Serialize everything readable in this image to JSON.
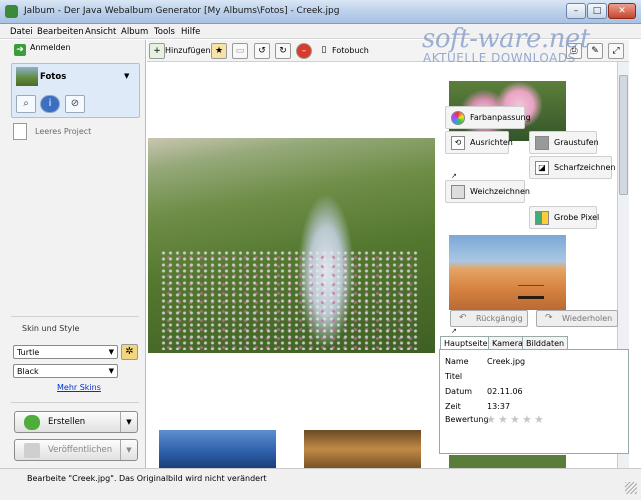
{
  "window": {
    "title": "Jalbum - Der Java Webalbum Generator [My Albums\\Fotos] - Creek.jpg",
    "min_glyph": "–",
    "max_glyph": "□",
    "close_glyph": "✕"
  },
  "menu": [
    "Datei",
    "Bearbeiten",
    "Ansicht",
    "Album",
    "Tools",
    "Hilfe"
  ],
  "watermark": {
    "line1": "soft-ware.net",
    "line2": "AKTUELLE DOWNLOADS"
  },
  "left": {
    "login_label": "Anmelden",
    "album_title": "Fotos",
    "project_label": "Leeres Project",
    "skin_section": "Skin und Style",
    "skin_value": "Turtle",
    "style_value": "Black",
    "more_skins": "Mehr Skins",
    "make_label": "Erstellen",
    "publish_label": "Veröffentlichen"
  },
  "toolbar": {
    "add_label": "Hinzufügen",
    "book_label": "Fotobuch"
  },
  "edit": {
    "color": "Farbanpassung",
    "align": "Ausrichten",
    "gray": "Graustufen",
    "sharpen": "Scharfzeichnen",
    "soften": "Weichzeichnen",
    "pixel": "Grobe Pixel",
    "undo": "Rückgängig",
    "redo": "Wiederholen"
  },
  "info": {
    "tabs": [
      "Hauptseite",
      "Kamera",
      "Bilddaten"
    ],
    "fields": [
      {
        "label": "Name",
        "value": "Creek.jpg"
      },
      {
        "label": "Titel",
        "value": ""
      },
      {
        "label": "Datum",
        "value": "02.11.06"
      },
      {
        "label": "Zeit",
        "value": "13:37"
      },
      {
        "label": "Bewertung",
        "value": ""
      }
    ],
    "rating": 0,
    "rating_max": 5
  },
  "status": "Bearbeite \"Creek.jpg\". Das Originalbild wird nicht verändert",
  "colors": {
    "accent": "#3a9c3a",
    "selection": "#dfeaf8"
  }
}
